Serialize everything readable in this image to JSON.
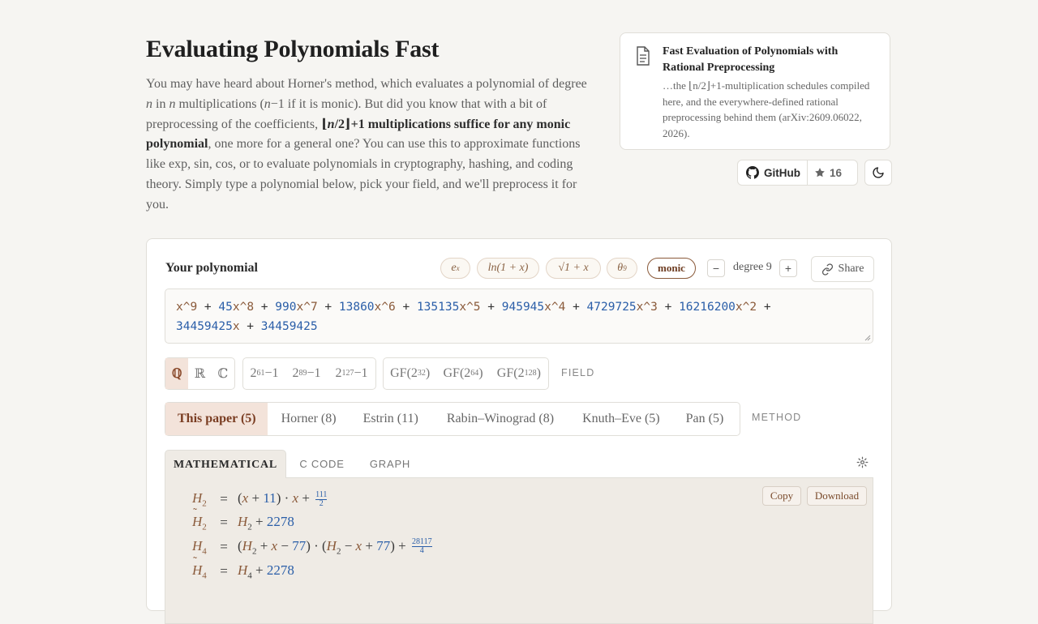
{
  "header": {
    "title": "Evaluating Polynomials Fast",
    "intro_1": "You may have heard about Horner's method, which evaluates a polynomial of degree ",
    "intro_n1": "n",
    "intro_2": " in ",
    "intro_n2": "n",
    "intro_3": " multiplications (",
    "intro_n3": "n",
    "intro_4": "−1 if it is monic). But did you know that with a bit of preprocessing of the coefficients, ",
    "intro_bold_a": "⌊",
    "intro_bold_n": "n",
    "intro_bold_b": "/2⌋+1 multiplications suffice for any monic polynomial",
    "intro_5": ", one more for a general one? You can use this to approximate functions like exp, sin, cos, or to evaluate polynomials in cryptography, hashing, and coding theory. Simply type a polynomial below, pick your field, and we'll preprocess it for you."
  },
  "paper": {
    "icon": "document-icon",
    "title": "Fast Evaluation of Polynomials with Rational Preprocessing",
    "excerpt": "…the ⌊n/2⌋+1-multiplication schedules compiled here, and the everywhere-defined rational preprocessing behind them (arXiv:2609.06022, 2026)."
  },
  "github": {
    "label": "GitHub",
    "stars": "16"
  },
  "editor": {
    "label": "Your polynomial",
    "presets": [
      "e",
      "x",
      "ln(1 + x)",
      "√1 + x",
      "θ",
      "9"
    ],
    "monic_label": "monic",
    "minus": "−",
    "plus": "+",
    "degree_label": "degree 9",
    "share_label": "Share",
    "polynomial": {
      "t1": "x^9",
      "o1": " + ",
      "c2": "45",
      "t2": "x^8",
      "o2": " + ",
      "c3": "990",
      "t3": "x^7",
      "o3": " + ",
      "c4": "13860",
      "t4": "x^6",
      "o4": " + ",
      "c5": "135135",
      "t5": "x^5",
      "o5": " + ",
      "c6": "945945",
      "t6": "x^4",
      "o6": " + ",
      "c7": "4729725",
      "t7": "x^3",
      "o7": " + ",
      "c8": "16216200",
      "t8": "x^2",
      "o8": " +",
      "c9": "34459425",
      "t9": "x",
      "o9": " + ",
      "c10": "34459425"
    }
  },
  "fields": {
    "basic": [
      "ℚ",
      "ℝ",
      "ℂ"
    ],
    "primes": [
      {
        "base": "2",
        "exp": "61",
        "rest": "−1"
      },
      {
        "base": "2",
        "exp": "89",
        "rest": "−1"
      },
      {
        "base": "2",
        "exp": "127",
        "rest": "−1"
      }
    ],
    "gf": [
      {
        "pre": "GF(2",
        "exp": "32",
        "post": ")"
      },
      {
        "pre": "GF(2",
        "exp": "64",
        "post": ")"
      },
      {
        "pre": "GF(2",
        "exp": "128",
        "post": ")"
      }
    ],
    "label": "FIELD"
  },
  "methods": {
    "items": [
      "This paper (5)",
      "Horner (8)",
      "Estrin (11)",
      "Rabin–Winograd (8)",
      "Knuth–Eve (5)",
      "Pan (5)"
    ],
    "label": "METHOD"
  },
  "tabs": [
    "MATHEMATICAL",
    "C CODE",
    "GRAPH"
  ],
  "output": {
    "copy_label": "Copy",
    "download_label": "Download",
    "equations": [
      {
        "lhs": "H",
        "sub": "2",
        "eq": "=",
        "p1": "(",
        "v1": "x",
        "p2": " + ",
        "n1": "11",
        "p3": ") · ",
        "v2": "x",
        "p4": " + ",
        "num": "111",
        "den": "2"
      },
      {
        "lhs": "H",
        "sub": "2",
        "tilde": "˜",
        "eq": "=",
        "h": "H",
        "hsub": "2",
        "p1": " + ",
        "n1": "2278"
      },
      {
        "lhs": "H",
        "sub": "4",
        "eq": "=",
        "p1": "(",
        "h1": "H",
        "h1sub": "2",
        "p2": " + ",
        "v1": "x",
        "p3": " − ",
        "n1": "77",
        "p4": ") · (",
        "h2": "H",
        "h2sub": "2",
        "p5": " − ",
        "v2": "x",
        "p6": " + ",
        "n2": "77",
        "p7": ") + ",
        "num": "28117",
        "den": "4"
      },
      {
        "lhs": "H",
        "sub": "4",
        "tilde": "˜",
        "eq": "=",
        "h": "H",
        "hsub": "4",
        "p1": " + ",
        "n1": "2278"
      }
    ]
  },
  "colors": {
    "accent": "#8a4a2c",
    "number": "#2a5ea8",
    "page": "#f6f5f2"
  }
}
